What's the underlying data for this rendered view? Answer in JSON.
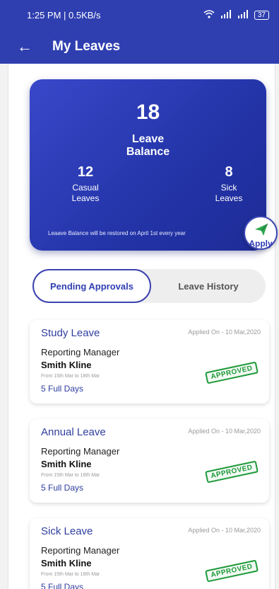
{
  "status_bar": {
    "time_speed": "1:25 PM | 0.5KB/s",
    "battery": "37"
  },
  "app_bar": {
    "back_glyph": "←",
    "title": "My Leaves"
  },
  "balance": {
    "total": "18",
    "total_label_line1": "Leave",
    "total_label_line2": "Balance",
    "casual_count": "12",
    "casual_label_line1": "Casual",
    "casual_label_line2": "Leaves",
    "sick_count": "8",
    "sick_label_line1": "Sick",
    "sick_label_line2": "Leaves",
    "note": "Leaave Balance will be restored on April 1st every year"
  },
  "apply": {
    "label": "Apply",
    "icon": "send-icon",
    "accent": "#2fa84f"
  },
  "tabs": [
    {
      "label": "Pending Approvals",
      "active": true
    },
    {
      "label": "Leave History",
      "active": false
    }
  ],
  "leaves": [
    {
      "type": "Study Leave",
      "applied": "Applied On - 10 Mar,2020",
      "role": "Reporting Manager",
      "manager": "Smith Kline",
      "range": "From 15th Mar to 18th Mar",
      "days": "5 Full Days",
      "status": "APPROVED"
    },
    {
      "type": "Annual Leave",
      "applied": "Applied On - 10 Mar,2020",
      "role": "Reporting Manager",
      "manager": "Smith Kline",
      "range": "From 15th Mar to 18th Mar",
      "days": "5 Full Days",
      "status": "APPROVED"
    },
    {
      "type": "Sick Leave",
      "applied": "Applied On - 10 Mar,2020",
      "role": "Reporting Manager",
      "manager": "Smith Kline",
      "range": "From 15th Mar to 18th Mar",
      "days": "5 Full Days",
      "status": "APPROVED"
    }
  ],
  "colors": {
    "primary": "#2f3fb0",
    "approved": "#1f9a3a"
  }
}
